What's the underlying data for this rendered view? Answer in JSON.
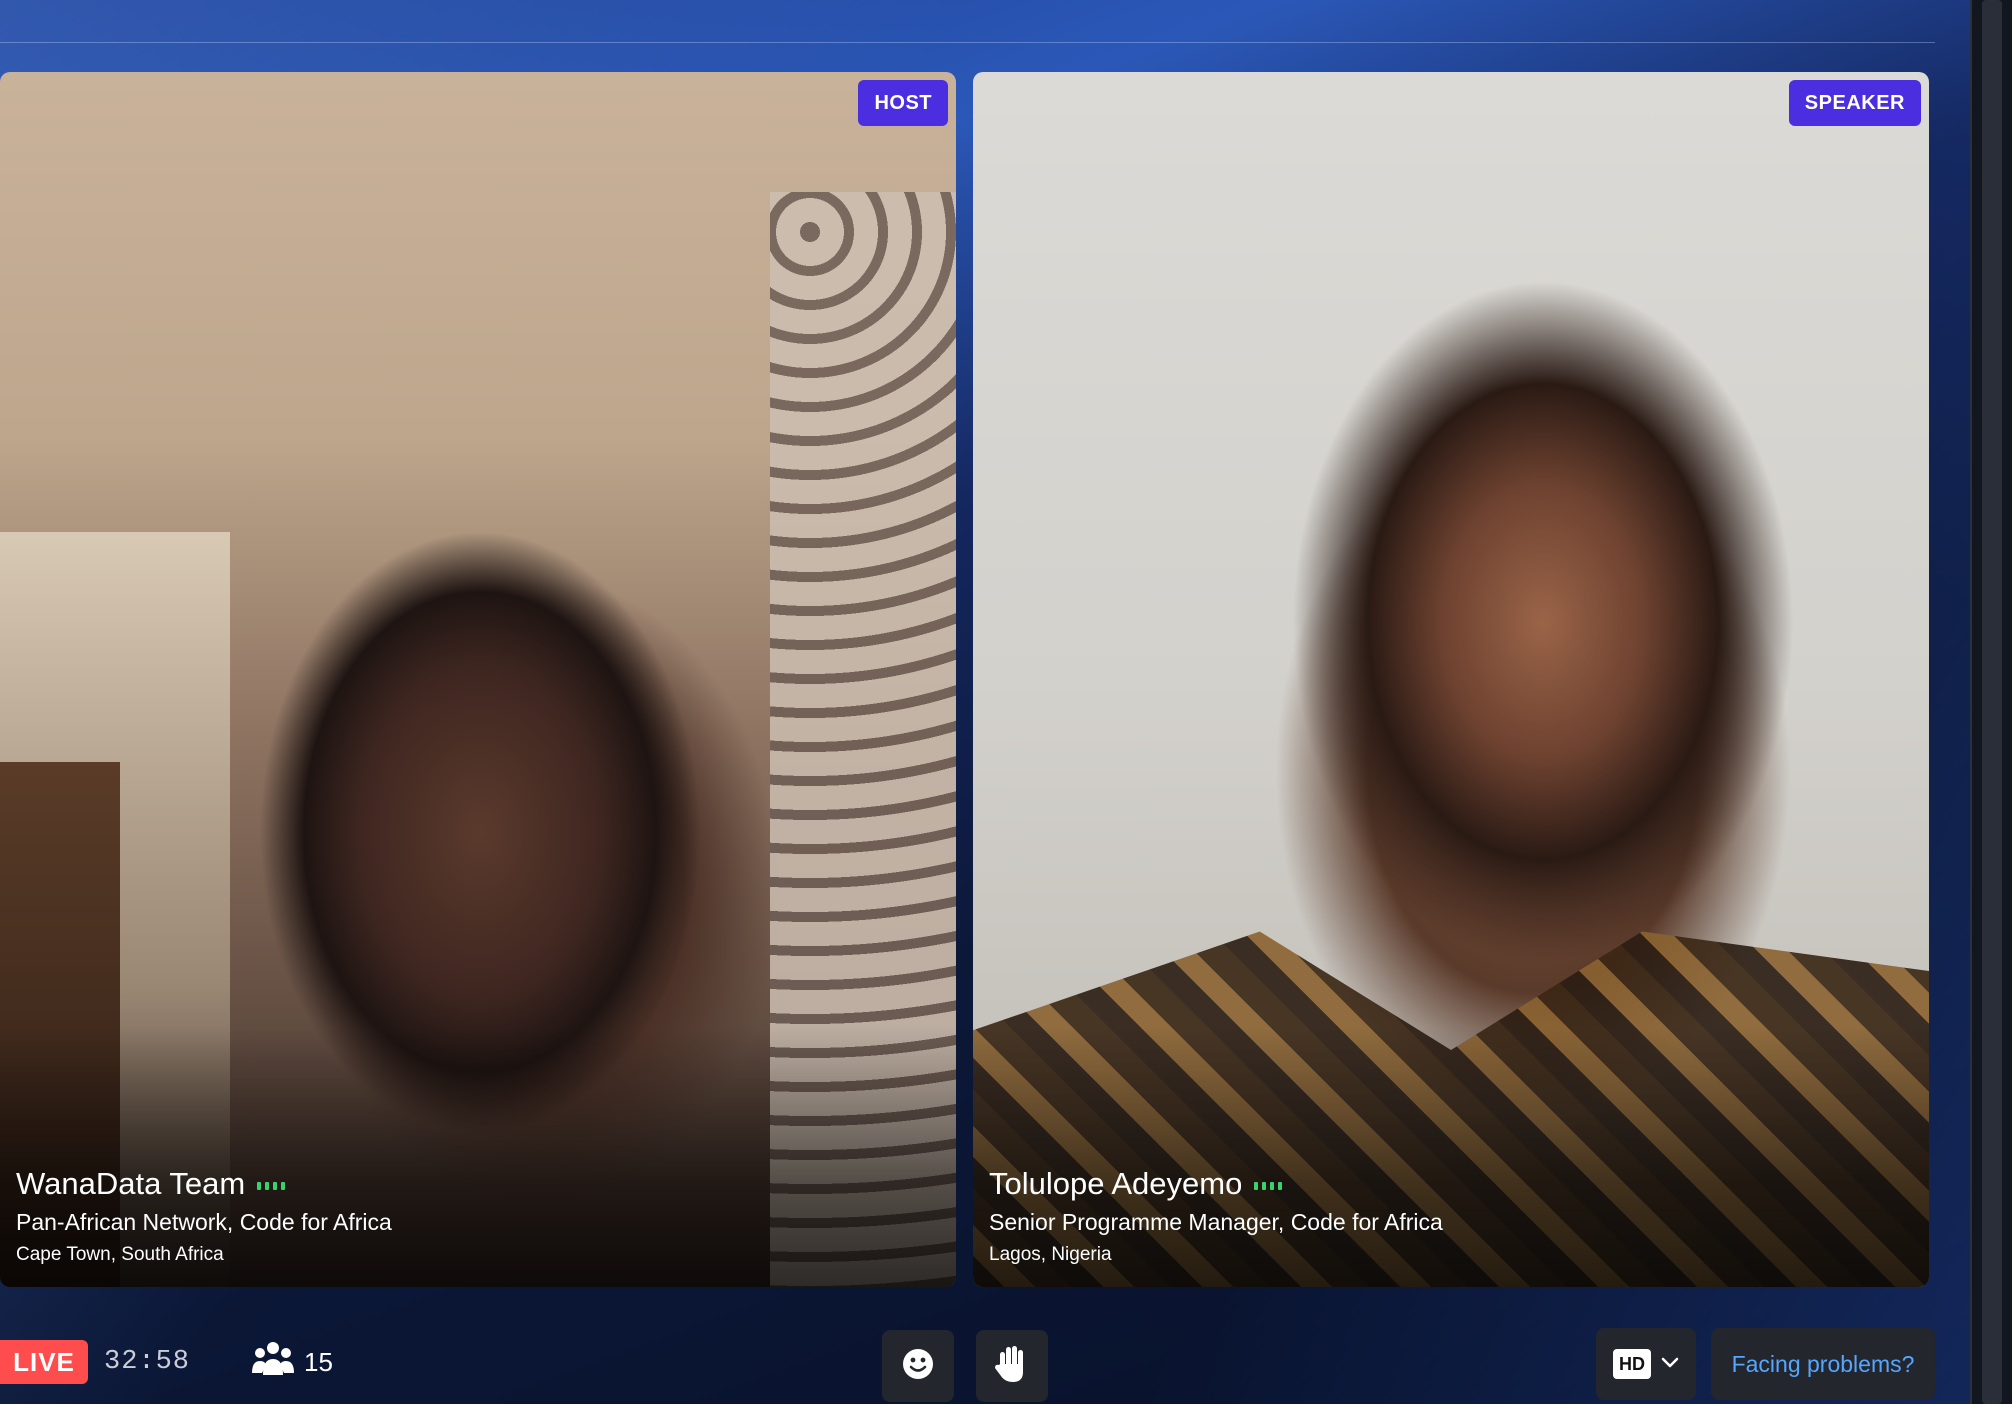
{
  "participants": [
    {
      "role": "HOST",
      "name": "WanaData Team",
      "title": "Pan-African Network, Code for Africa",
      "location": "Cape Town, South Africa"
    },
    {
      "role": "SPEAKER",
      "name": "Tolulope Adeyemo",
      "title": "Senior Programme Manager, Code for Africa",
      "location": "Lagos, Nigeria"
    }
  ],
  "bottom_bar": {
    "live_label": "LIVE",
    "elapsed": "32:58",
    "attendee_count": "15",
    "quality_label": "HD",
    "help_label": "Facing problems?"
  },
  "icons": {
    "audio": "audio-level-icon",
    "attendees": "people-icon",
    "emoji": "smiley-icon",
    "raise_hand": "hand-icon",
    "chevron": "chevron-down-icon"
  },
  "colors": {
    "badge": "#4a2ee0",
    "live": "#ff4d4d",
    "audio_active": "#3bd16f",
    "link": "#55a6ff"
  }
}
